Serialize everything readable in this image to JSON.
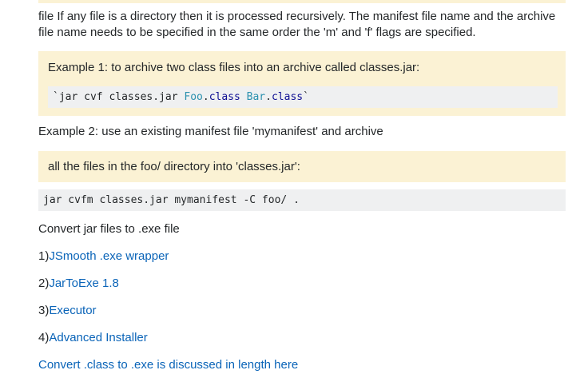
{
  "intro_text": "file If any file is a directory then it is processed recursively. The manifest file name and the archive file name needs to be specified in the same order the 'm' and 'f' flags are specified.",
  "example1": {
    "text": "Example 1: to archive two class files into an archive called classes.jar:",
    "code": {
      "tick_open": "`",
      "cmd": "jar cvf classes.jar ",
      "foo": "Foo",
      "dot1": ".",
      "class1": "class",
      "space": " ",
      "bar": "Bar",
      "dot2": ".",
      "class2": "class",
      "tick_close": "`"
    }
  },
  "example2": {
    "text": "Example 2: use an existing manifest file 'mymanifest' and archive",
    "quote": "all the files in the foo/ directory into 'classes.jar':",
    "code": "jar cvfm classes.jar mymanifest -C foo/ ."
  },
  "convert_heading": "Convert jar files to .exe file",
  "tools": [
    {
      "num": "1)",
      "label": "JSmooth .exe wrapper"
    },
    {
      "num": "2)",
      "label": "JarToExe 1.8"
    },
    {
      "num": "3)",
      "label": "Executor"
    },
    {
      "num": "4)",
      "label": "Advanced Installer"
    }
  ],
  "final_link": "Convert .class to .exe is discussed in length here",
  "colors": {
    "quote_bg": "#fbf2d4",
    "code_bg": "#eff0f1",
    "link": "#0a64b8",
    "keyword": "#101094",
    "type": "#2b91af"
  }
}
